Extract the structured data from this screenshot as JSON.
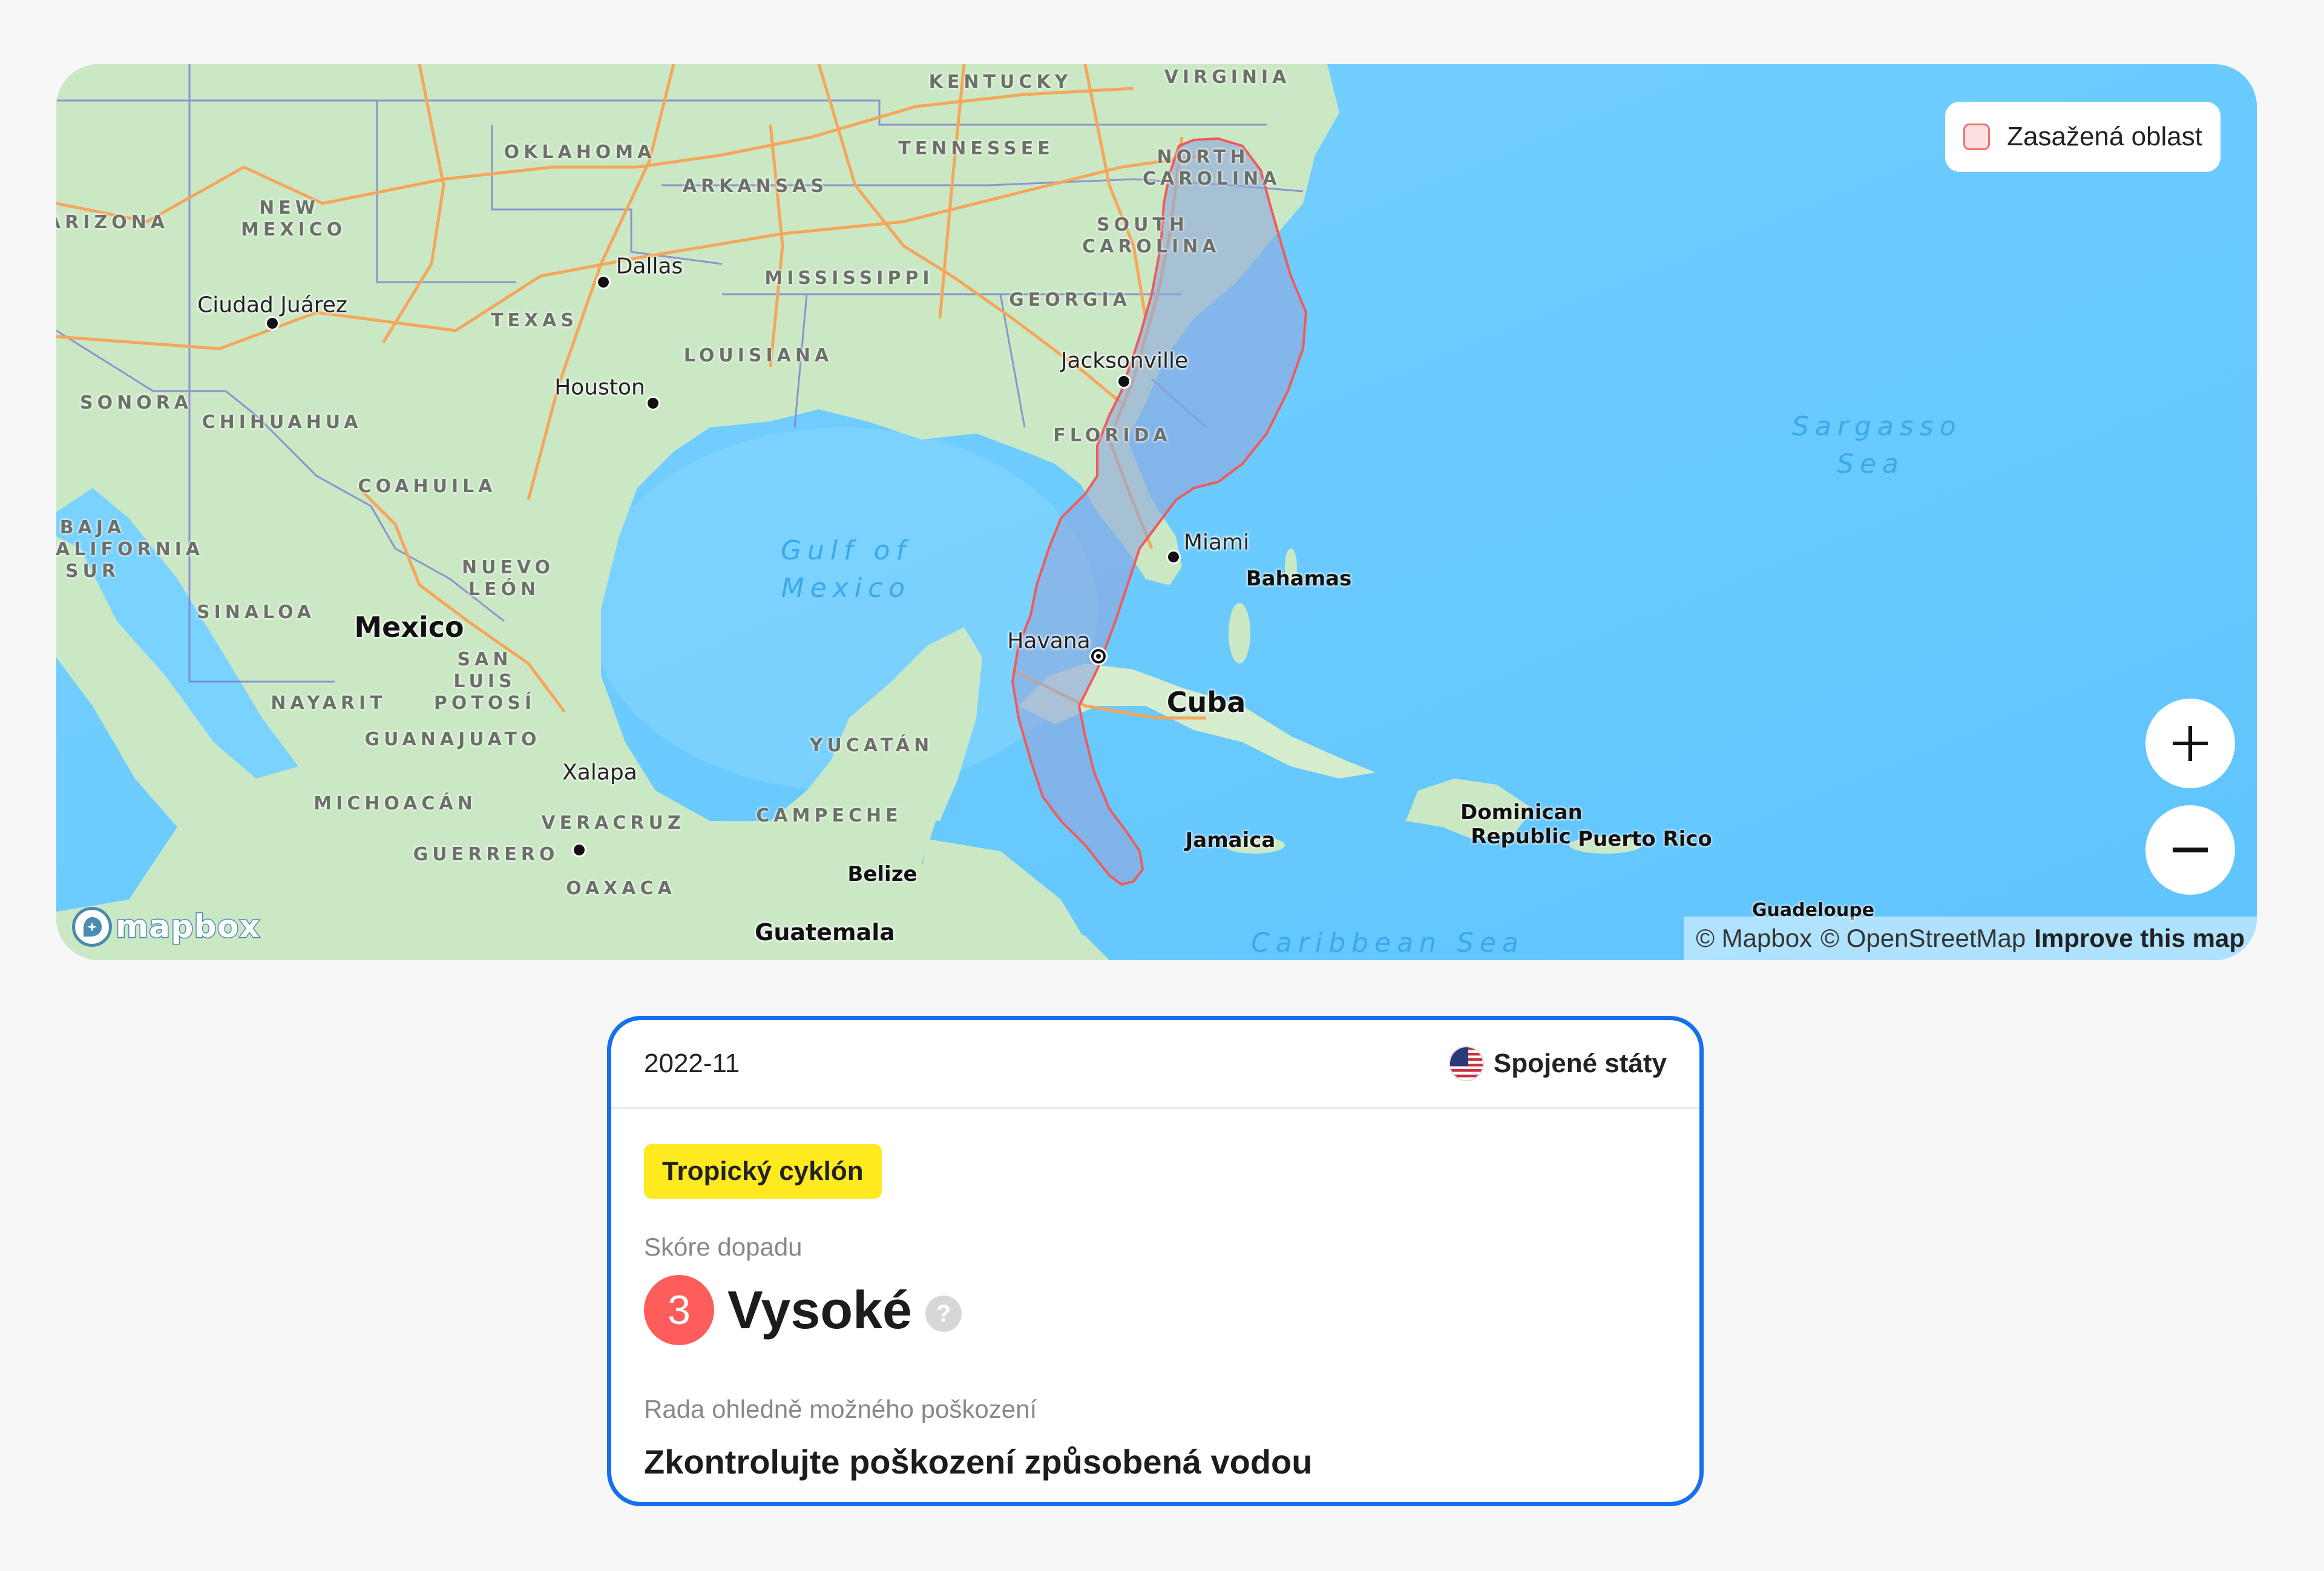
{
  "map": {
    "legend": {
      "label": "Zasažená oblast",
      "fill_color": "#fde0e0",
      "stroke_color": "#f07070"
    },
    "zoom_in_label": "+",
    "zoom_out_label": "−",
    "logo_text": "mapbox",
    "attribution": {
      "mapbox": "© Mapbox",
      "osm": "© OpenStreetMap",
      "improve": "Improve this map"
    },
    "colors": {
      "water": "#62c6fd",
      "land": "#cbe8c5",
      "road": "#f5a65b",
      "border": "#7a7fd0",
      "affected_fill": "#8fa8dd",
      "affected_stroke": "#f05a5a"
    },
    "labels": {
      "states": [
        "KENTUCKY",
        "VIRGINIA",
        "OKLAHOMA",
        "TENNESSEE",
        "NORTH CAROLINA",
        "ARKANSAS",
        "ARIZONA",
        "NEW MEXICO",
        "SOUTH CAROLINA",
        "MISSISSIPPI",
        "GEORGIA",
        "TEXAS",
        "LOUISIANA",
        "FLORIDA",
        "SONORA",
        "CHIHUAHUA",
        "COAHUILA",
        "BAJA CALIFORNIA SUR",
        "NUEVO LEÓN",
        "SINALOA",
        "SAN LUIS POTOSÍ",
        "NAYARIT",
        "GUANAJUATO",
        "MICHOACÁN",
        "VERACRUZ",
        "GUERRERO",
        "OAXACA",
        "YUCATÁN",
        "CAMPECHE"
      ],
      "cities": [
        "Dallas",
        "Ciudad Juárez",
        "Houston",
        "Jacksonville",
        "Miami",
        "Havana",
        "Xalapa"
      ],
      "countries": [
        "Mexico",
        "Cuba",
        "Bahamas",
        "Jamaica",
        "Dominican Republic",
        "Puerto Rico",
        "Belize",
        "Guatemala",
        "Guadeloupe"
      ],
      "seas": [
        "Gulf of Mexico",
        "Sargasso Sea",
        "Caribbean Sea"
      ]
    }
  },
  "card": {
    "date": "2022-11",
    "country": "Spojené státy",
    "event_type": "Tropický cyklón",
    "impact_label": "Skóre dopadu",
    "impact_score": "3",
    "impact_text": "Vysoké",
    "help_icon": "?",
    "advice_label": "Rada ohledně možného poškození",
    "advice_text": "Zkontrolujte poškození způsobená vodou",
    "colors": {
      "border": "#1570ef",
      "badge": "#ffea1f",
      "score": "#ff5c5c"
    }
  }
}
